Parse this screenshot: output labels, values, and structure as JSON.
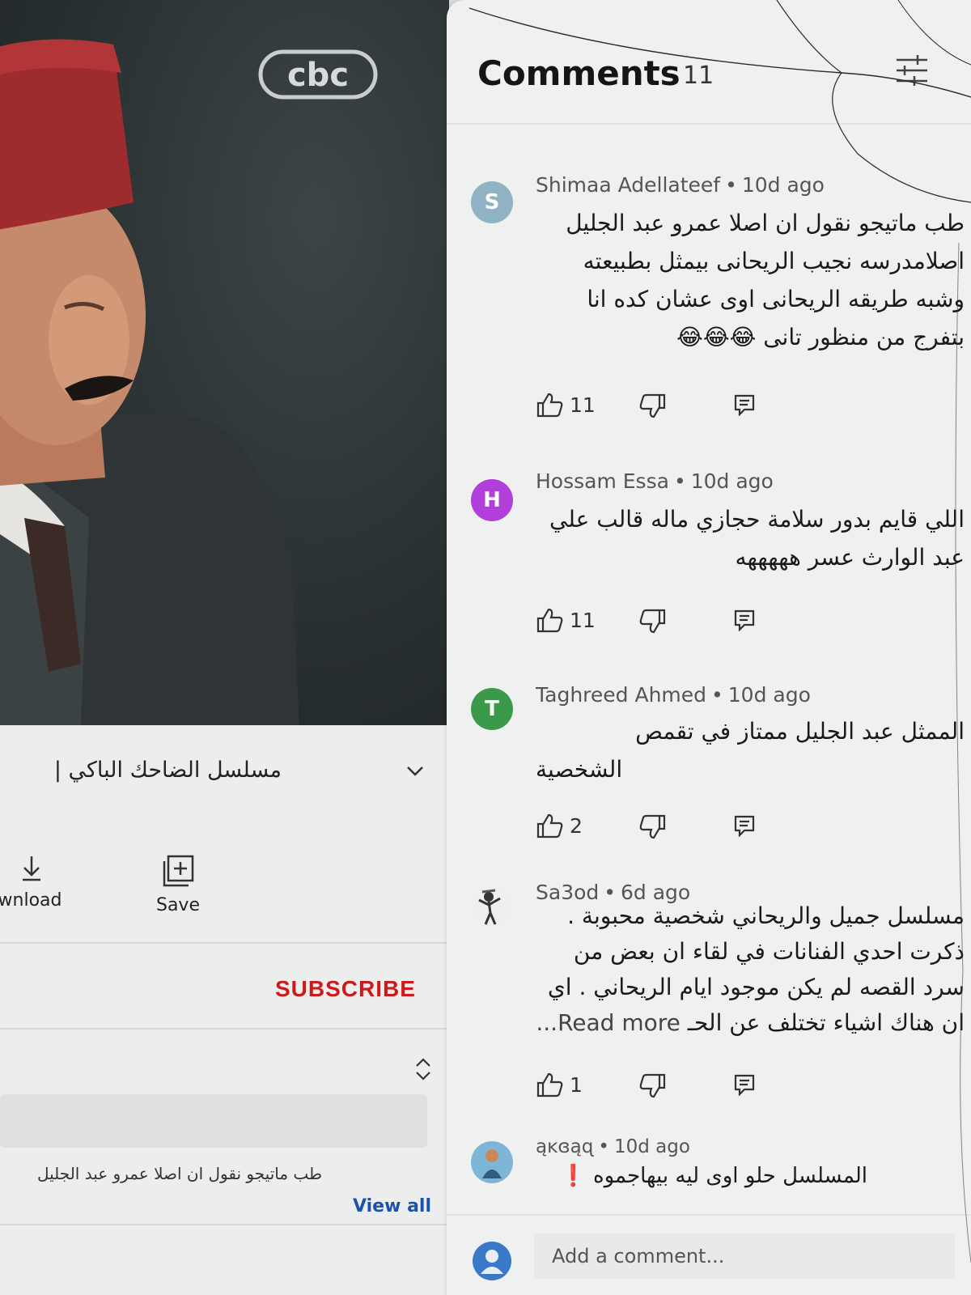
{
  "video": {
    "channel_logo_text": "cbc",
    "title": "مسلسل الضاحك الباكي |",
    "actions": [
      {
        "label": "wnload",
        "icon": "download-icon"
      },
      {
        "label": "Save",
        "icon": "save-playlist-icon"
      }
    ],
    "subscribe_label": "SUBSCRIBE",
    "comment_preview": "طب ماتيجو نقول ان اصلا عمرو عبد الجليل",
    "view_all_label": "View all"
  },
  "panel": {
    "title": "Comments",
    "count": "11",
    "filter_icon": "sort-filter-icon"
  },
  "comments": [
    {
      "avatar_letter": "S",
      "avatar_color": "#8fb3c2",
      "author": "Shimaa Adellateef",
      "time": "10d ago",
      "lines": [
        "طب ماتيجو نقول ان اصلا عمرو عبد الجليل",
        "اصلامدرسه نجيب الريحانى بيمثل بطبيعته",
        "وشبه طريقه الريحانى اوى عشان كده انا",
        "بتفرج من منظور تانى 😂😂😂"
      ],
      "likes": "11"
    },
    {
      "avatar_letter": "H",
      "avatar_color": "#b23fd9",
      "author": "Hossam Essa",
      "time": "10d ago",
      "lines": [
        "اللي قايم بدور سلامة حجازي ماله قالب علي",
        "عبد الوارث عسر هههههه"
      ],
      "likes": "11"
    },
    {
      "avatar_letter": "T",
      "avatar_color": "#3b9a4a",
      "author": "Taghreed Ahmed",
      "time": "10d ago",
      "lines": [
        "الممثل عبد الجليل ممتاز في تقمص",
        "الشخصية"
      ],
      "likes": "2"
    },
    {
      "avatar_letter": "",
      "avatar_color": "#efefef",
      "author": "Sa3od",
      "time": "6d ago",
      "lines": [
        "مسلسل جميل والريحاني شخصية محبوبة .",
        "ذكرت احدي الفنانات في لقاء ان بعض من",
        "سرد القصه لم يكن موجود ايام الريحاني . اي",
        "ان هناك اشياء تختلف عن الحـ"
      ],
      "read_more": "Read more...",
      "likes": "1"
    },
    {
      "avatar_letter": "",
      "avatar_color": "#7db6d6",
      "author": "ąĸɞąɋ",
      "time": "10d ago",
      "lines": [
        "المسلسل حلو اوى ليه بيهاجموه ❗"
      ],
      "likes": ""
    }
  ],
  "add_comment": {
    "placeholder": "Add a comment..."
  }
}
